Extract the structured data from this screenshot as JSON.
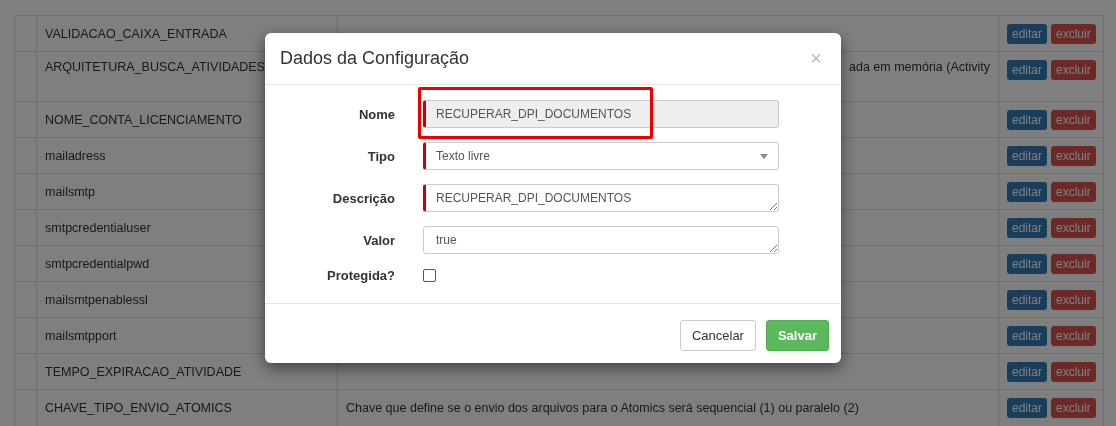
{
  "table": {
    "rows": [
      {
        "name": "VALIDACAO_CAIXA_ENTRADA",
        "description": "",
        "clipped_start": false,
        "actions": [
          "editar",
          "excluir"
        ]
      },
      {
        "name": "ARQUITETURA_BUSCA_ATIVIDADES",
        "description": "ada em memória (Activity",
        "clipped_start": true,
        "actions": [
          "editar",
          "excluir"
        ]
      },
      {
        "name": "NOME_CONTA_LICENCIAMENTO",
        "description": "",
        "clipped_start": false,
        "actions": [
          "editar",
          "excluir"
        ]
      },
      {
        "name": "mailadress",
        "description": "",
        "clipped_start": false,
        "actions": [
          "editar",
          "excluir"
        ]
      },
      {
        "name": "mailsmtp",
        "description": "",
        "clipped_start": false,
        "actions": [
          "editar",
          "excluir"
        ]
      },
      {
        "name": "smtpcredentialuser",
        "description": "",
        "clipped_start": false,
        "actions": [
          "editar",
          "excluir"
        ]
      },
      {
        "name": "smtpcredentialpwd",
        "description": "",
        "clipped_start": false,
        "actions": [
          "editar",
          "excluir"
        ]
      },
      {
        "name": "mailsmtpenablessl",
        "description": "",
        "clipped_start": false,
        "actions": [
          "editar",
          "excluir"
        ]
      },
      {
        "name": "mailsmtpport",
        "description": "",
        "clipped_start": false,
        "actions": [
          "editar",
          "excluir"
        ]
      },
      {
        "name": "TEMPO_EXPIRACAO_ATIVIDADE",
        "description": "",
        "clipped_start": false,
        "actions": [
          "editar",
          "excluir"
        ]
      },
      {
        "name": "CHAVE_TIPO_ENVIO_ATOMICS",
        "description": "Chave que define se o envio dos arquivos para o Atomics será sequencial (1) ou paralelo (2)",
        "clipped_start": false,
        "actions": [
          "editar",
          "excluir"
        ]
      }
    ]
  },
  "modal": {
    "title": "Dados da Configuração",
    "close": "×",
    "fields": [
      {
        "kind": "text",
        "label": "Nome",
        "value": "RECUPERAR_DPI_DOCUMENTOS",
        "disabled": true,
        "flagged": true,
        "highlighted": true
      },
      {
        "kind": "select",
        "label": "Tipo",
        "value": "Texto livre",
        "disabled": false,
        "flagged": true
      },
      {
        "kind": "textarea",
        "label": "Descrição",
        "value": "RECUPERAR_DPI_DOCUMENTOS",
        "disabled": false,
        "flagged": true
      },
      {
        "kind": "textarea",
        "label": "Valor",
        "value": "true",
        "disabled": false,
        "flagged": false
      },
      {
        "kind": "checkbox",
        "label": "Protegida?",
        "checked": false
      }
    ],
    "buttons": [
      {
        "label": "Cancelar",
        "kind": "default"
      },
      {
        "label": "Salvar",
        "kind": "primary"
      }
    ]
  }
}
